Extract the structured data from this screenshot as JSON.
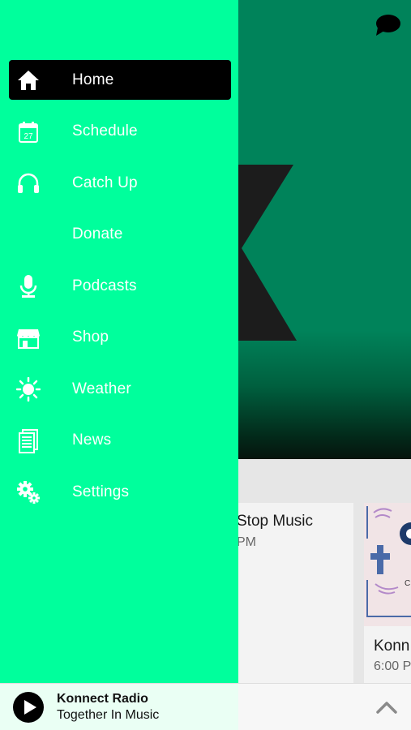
{
  "menu": {
    "items": [
      {
        "label": "Home",
        "icon": "home-icon",
        "active": true
      },
      {
        "label": "Schedule",
        "icon": "calendar-icon",
        "active": false
      },
      {
        "label": "Catch Up",
        "icon": "headphones-icon",
        "active": false
      },
      {
        "label": "Donate",
        "icon": "",
        "active": false
      },
      {
        "label": "Podcasts",
        "icon": "microphone-icon",
        "active": false
      },
      {
        "label": "Shop",
        "icon": "shop-icon",
        "active": false
      },
      {
        "label": "Weather",
        "icon": "sun-icon",
        "active": false
      },
      {
        "label": "News",
        "icon": "news-icon",
        "active": false
      },
      {
        "label": "Settings",
        "icon": "gear-icon",
        "active": false
      }
    ],
    "calendar_day": "27"
  },
  "cards": [
    {
      "title": "Stop Music",
      "subtitle": "PM"
    },
    {
      "title": "Konn",
      "subtitle": "6:00 P"
    }
  ],
  "player": {
    "title": "Konnect Radio",
    "subtitle": "Together In Music"
  },
  "colors": {
    "drawer": "#00ff9c",
    "hero": "#00835a",
    "active_item": "#000000"
  }
}
